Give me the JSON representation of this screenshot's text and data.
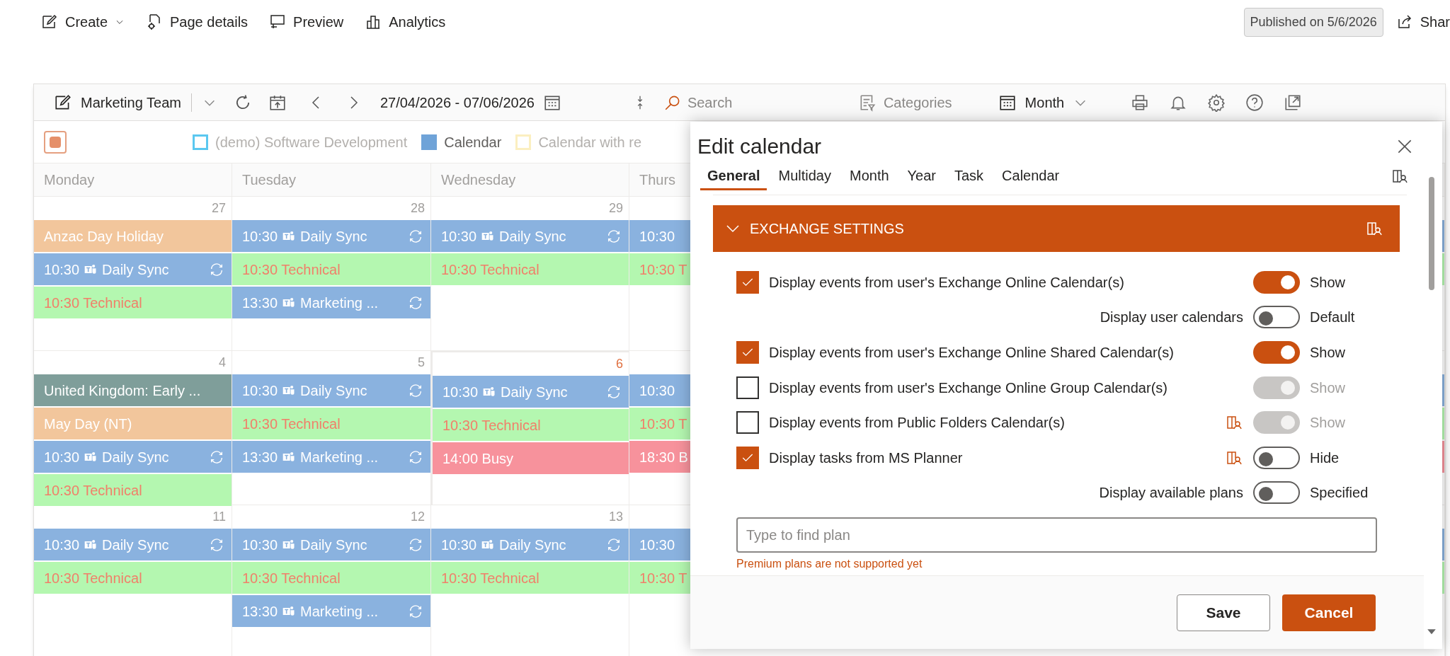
{
  "top_bar": {
    "items": [
      {
        "kind": "edit",
        "label": "Create",
        "dropdown": true
      },
      {
        "kind": "page-gear",
        "label": "Page details",
        "dropdown": false
      },
      {
        "kind": "preview",
        "label": "Preview",
        "dropdown": false
      },
      {
        "kind": "chart",
        "label": "Analytics",
        "dropdown": false
      }
    ],
    "published": "Published on 5/6/2026",
    "share": "Shar"
  },
  "toolbar": {
    "calendar_name": "Marketing Team",
    "date_range": "27/04/2026 - 07/06/2026",
    "search": {
      "placeholder": "Search"
    },
    "categories": "Categories",
    "view": "Month"
  },
  "select_all": {
    "checked": true
  },
  "legend": [
    {
      "label": "(demo) Software Development",
      "color": "#5bc8f0",
      "filled": false
    },
    {
      "label": "Calendar",
      "color": "#6fa3d8",
      "filled": true
    },
    {
      "label": "Calendar with re",
      "color": "#fbefc0",
      "filled": false
    }
  ],
  "day_headers": [
    "Monday",
    "Tuesday",
    "Wednesday",
    "Thurs"
  ],
  "weeks": [
    {
      "days": [
        {
          "date": "27",
          "today": false,
          "events": [
            {
              "kind": "holiday",
              "title": "Anzac Day Holiday",
              "color": "#f2c69c"
            },
            {
              "kind": "meeting",
              "time": "10:30",
              "title": "Daily Sync",
              "color": "#8ab2df",
              "teams": true,
              "recurring": true
            },
            {
              "kind": "task",
              "time": "10:30",
              "title": "Technical",
              "color": "#b4f7b0"
            }
          ]
        },
        {
          "date": "28",
          "today": false,
          "events": [
            {
              "kind": "meeting",
              "time": "10:30",
              "title": "Daily Sync",
              "color": "#8ab2df",
              "teams": true,
              "recurring": true
            },
            {
              "kind": "task",
              "time": "10:30",
              "title": "Technical",
              "color": "#b4f7b0"
            },
            {
              "kind": "meeting",
              "time": "13:30",
              "title": "Marketing ...",
              "color": "#8ab2df",
              "teams": true,
              "recurring": true
            }
          ]
        },
        {
          "date": "29",
          "today": false,
          "events": [
            {
              "kind": "meeting",
              "time": "10:30",
              "title": "Daily Sync",
              "color": "#8ab2df",
              "teams": true,
              "recurring": true
            },
            {
              "kind": "task",
              "time": "10:30",
              "title": "Technical",
              "color": "#b4f7b0"
            }
          ]
        },
        {
          "today": false,
          "events": [
            {
              "kind": "meeting",
              "time": "10:30",
              "color": "#8ab2df",
              "teams": false,
              "recurring": false
            },
            {
              "kind": "task",
              "time": "10:30",
              "title": "T",
              "color": "#b4f7b0"
            }
          ]
        }
      ]
    },
    {
      "days": [
        {
          "date": "4",
          "today": false,
          "events": [
            {
              "kind": "holiday",
              "title": "United Kingdom: Early ...",
              "color": "#7f9e9a"
            },
            {
              "kind": "holiday",
              "title": "May Day (NT)",
              "color": "#f2c69c"
            },
            {
              "kind": "meeting",
              "time": "10:30",
              "title": "Daily Sync",
              "color": "#8ab2df",
              "teams": true,
              "recurring": true
            },
            {
              "kind": "task",
              "time": "10:30",
              "title": "Technical",
              "color": "#b4f7b0"
            }
          ]
        },
        {
          "date": "5",
          "today": false,
          "events": [
            {
              "kind": "meeting",
              "time": "10:30",
              "title": "Daily Sync",
              "color": "#8ab2df",
              "teams": true,
              "recurring": true
            },
            {
              "kind": "task",
              "time": "10:30",
              "title": "Technical",
              "color": "#b4f7b0"
            },
            {
              "kind": "meeting",
              "time": "13:30",
              "title": "Marketing ...",
              "color": "#8ab2df",
              "teams": true,
              "recurring": true
            }
          ]
        },
        {
          "date": "6",
          "today": true,
          "events": [
            {
              "kind": "meeting",
              "time": "10:30",
              "title": "Daily Sync",
              "color": "#8ab2df",
              "teams": true,
              "recurring": true
            },
            {
              "kind": "task",
              "time": "10:30",
              "title": "Technical",
              "color": "#b4f7b0"
            },
            {
              "kind": "busy",
              "time": "14:00",
              "title": "Busy",
              "color": "#f7929c"
            }
          ]
        },
        {
          "today": false,
          "events": [
            {
              "kind": "meeting",
              "time": "10:30",
              "color": "#8ab2df",
              "teams": false,
              "recurring": false
            },
            {
              "kind": "task",
              "time": "10:30",
              "title": "T",
              "color": "#b4f7b0"
            },
            {
              "kind": "busy",
              "time": "18:30",
              "title": "B",
              "color": "#f7929c"
            }
          ]
        }
      ]
    },
    {
      "days": [
        {
          "date": "11",
          "today": false,
          "events": [
            {
              "kind": "meeting",
              "time": "10:30",
              "title": "Daily Sync",
              "color": "#8ab2df",
              "teams": true,
              "recurring": true
            },
            {
              "kind": "task",
              "time": "10:30",
              "title": "Technical",
              "color": "#b4f7b0"
            }
          ]
        },
        {
          "date": "12",
          "today": false,
          "events": [
            {
              "kind": "meeting",
              "time": "10:30",
              "title": "Daily Sync",
              "color": "#8ab2df",
              "teams": true,
              "recurring": true
            },
            {
              "kind": "task",
              "time": "10:30",
              "title": "Technical",
              "color": "#b4f7b0"
            },
            {
              "kind": "meeting",
              "time": "13:30",
              "title": "Marketing ...",
              "color": "#8ab2df",
              "teams": true,
              "recurring": true
            }
          ]
        },
        {
          "date": "13",
          "today": false,
          "events": [
            {
              "kind": "meeting",
              "time": "10:30",
              "title": "Daily Sync",
              "color": "#8ab2df",
              "teams": true,
              "recurring": true
            },
            {
              "kind": "task",
              "time": "10:30",
              "title": "Technical",
              "color": "#b4f7b0"
            }
          ]
        },
        {
          "today": false,
          "events": [
            {
              "kind": "meeting",
              "time": "10:30",
              "color": "#8ab2df",
              "teams": false,
              "recurring": false
            },
            {
              "kind": "task",
              "time": "10:30",
              "title": "T",
              "color": "#b4f7b0"
            }
          ]
        }
      ]
    }
  ],
  "dialog": {
    "title": "Edit calendar",
    "tabs": [
      {
        "label": "General",
        "selected": true
      },
      {
        "label": "Multiday",
        "selected": false
      },
      {
        "label": "Month",
        "selected": false
      },
      {
        "label": "Year",
        "selected": false
      },
      {
        "label": "Task",
        "selected": false
      },
      {
        "label": "Calendar",
        "selected": false
      }
    ],
    "section": {
      "title": "EXCHANGE SETTINGS",
      "expanded": true
    },
    "rows": [
      {
        "kind": "source",
        "label": "Display events from user's Exchange Online Calendar(s)",
        "checked": true,
        "premium": false,
        "toggle": {
          "on": true,
          "disabled": false,
          "label": "Show"
        }
      },
      {
        "kind": "option",
        "label": "Display user calendars",
        "toggle": {
          "on": false,
          "disabled": false,
          "label": "Default"
        }
      },
      {
        "kind": "source",
        "label": "Display events from user's Exchange Online Shared Calendar(s)",
        "checked": true,
        "premium": false,
        "toggle": {
          "on": true,
          "disabled": false,
          "label": "Show"
        }
      },
      {
        "kind": "source",
        "label": "Display events from user's Exchange Online Group Calendar(s)",
        "checked": false,
        "premium": false,
        "toggle": {
          "on": true,
          "disabled": true,
          "label": "Show"
        }
      },
      {
        "kind": "source",
        "label": "Display events from Public Folders Calendar(s)",
        "checked": false,
        "premium": true,
        "toggle": {
          "on": true,
          "disabled": true,
          "label": "Show"
        }
      },
      {
        "kind": "source",
        "label": "Display tasks from MS Planner",
        "checked": true,
        "premium": true,
        "toggle": {
          "on": false,
          "disabled": false,
          "label": "Hide"
        }
      },
      {
        "kind": "option",
        "label": "Display available plans",
        "toggle": {
          "on": false,
          "disabled": false,
          "label": "Specified"
        }
      }
    ],
    "plan_search": {
      "placeholder": "Type to find plan"
    },
    "note": "Premium plans are not supported yet",
    "buttons": [
      {
        "label": "Save",
        "primary": false
      },
      {
        "label": "Cancel",
        "primary": true
      }
    ]
  }
}
